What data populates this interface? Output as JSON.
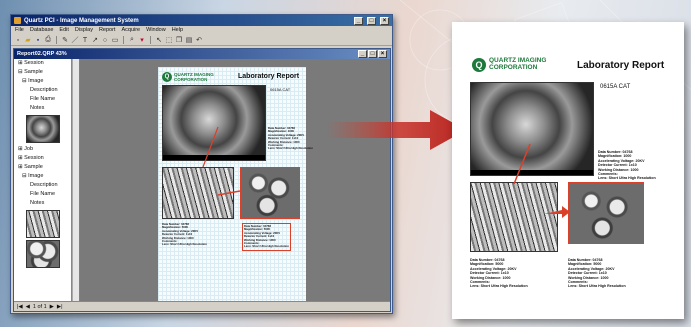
{
  "window": {
    "title": "Quartz PCI - Image Management System"
  },
  "menu": [
    "File",
    "Database",
    "Edit",
    "Display",
    "Report",
    "Acquire",
    "Window",
    "Help"
  ],
  "toolbar": {
    "icons": [
      "new-icon",
      "open-icon",
      "save-icon",
      "print-icon",
      "pencil-icon",
      "line-icon",
      "text-icon",
      "arrow-icon",
      "circle-icon",
      "rect-icon",
      "zoom-icon",
      "pointer-icon",
      "select-icon",
      "copy-icon",
      "paste-icon",
      "undo-icon"
    ]
  },
  "doc_window": {
    "title": "Report02.QRP 43%"
  },
  "tree": {
    "group1": [
      "Session",
      "Sample",
      "Image",
      "Description",
      "File Name",
      "Notes"
    ],
    "group2": [
      "Job",
      "Session",
      "Sample",
      "Image",
      "Description",
      "File Name",
      "Notes"
    ]
  },
  "pager": {
    "page_label": "1 of 1"
  },
  "report": {
    "company_line1": "QUARTZ IMAGING",
    "company_line2": "CORPORATION",
    "title": "Laboratory Report",
    "sample": "0615A CAT",
    "specs": [
      "Data Number: 04768",
      "Magnification: 1000",
      "Accelerating Voltage: 20KV",
      "Detector Current: 1x10",
      "Working Distance: 1000",
      "Comments:",
      "Lens: Short Ultra High Resolution"
    ],
    "small_specs": [
      "Data Number: 04768",
      "Magnification: 5000",
      "Accelerating Voltage: 20KV",
      "Detector Current: 1x10",
      "Working Distance: 1000",
      "Comments:",
      "Lens: Short Ultra High Resolution"
    ]
  },
  "colors": {
    "accent": "#d9412a",
    "brand": "#1e7a3c",
    "titlebar": "#0a246a"
  }
}
